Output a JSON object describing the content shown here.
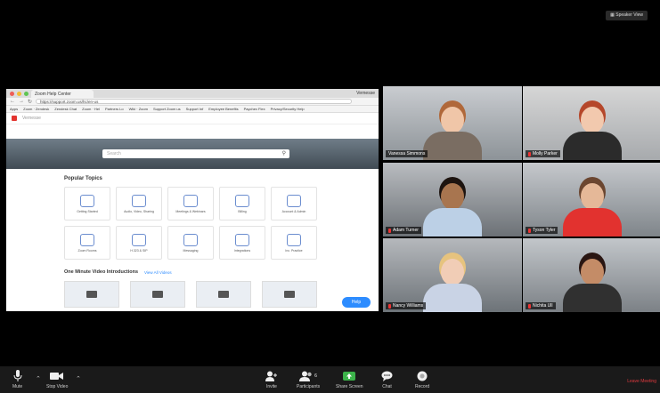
{
  "browser": {
    "tab_title": "Zoom Help Center",
    "user_label": "Vernesse",
    "url": "https://support.zoom.us/hc/en-us",
    "bookmarks": [
      "Apps",
      "Zoom · Zendesk",
      "Zendesk Chat",
      "Zoom · Hel",
      "Partners Lo",
      "Wiki · Zoom",
      "Support Zoom us",
      "Support Inf",
      "Employee Benefits",
      "Paychex Flex",
      "Privacy/Security Help"
    ],
    "site_search_placeholder": "Search",
    "popular_topics_title": "Popular Topics",
    "topics": [
      "Getting Started",
      "Audio, Video, Sharing",
      "Meetings & Webinars",
      "Billing",
      "Account & Admin",
      "Zoom Rooms",
      "H.323 & SIP",
      "Messaging",
      "Integrations",
      "Inc. Practice"
    ],
    "videos_title": "One Minute Video Introductions",
    "videos_link": "View All Videos",
    "help_button": "Help"
  },
  "gallery": {
    "speaker_view_label": "Speaker View",
    "participants": [
      {
        "name": "Vanessa Simmons",
        "active": true
      },
      {
        "name": "Molly Parker",
        "active": false
      },
      {
        "name": "Adam Turner",
        "active": false
      },
      {
        "name": "Tyson Tyler",
        "active": false
      },
      {
        "name": "Nancy Williams",
        "active": false
      },
      {
        "name": "Nichita Ull",
        "active": false
      }
    ]
  },
  "toolbar": {
    "mute": "Mute",
    "stop_video": "Stop Video",
    "invite": "Invite",
    "participants": "Participants",
    "participants_count": "6",
    "share_screen": "Share Screen",
    "chat": "Chat",
    "record": "Record",
    "leave": "Leave Meeting"
  },
  "colors": {
    "active_speaker_border": "#a6d96a",
    "zoom_blue": "#2d8cff",
    "leave_red": "#e0393e",
    "share_green": "#3cb34a"
  }
}
